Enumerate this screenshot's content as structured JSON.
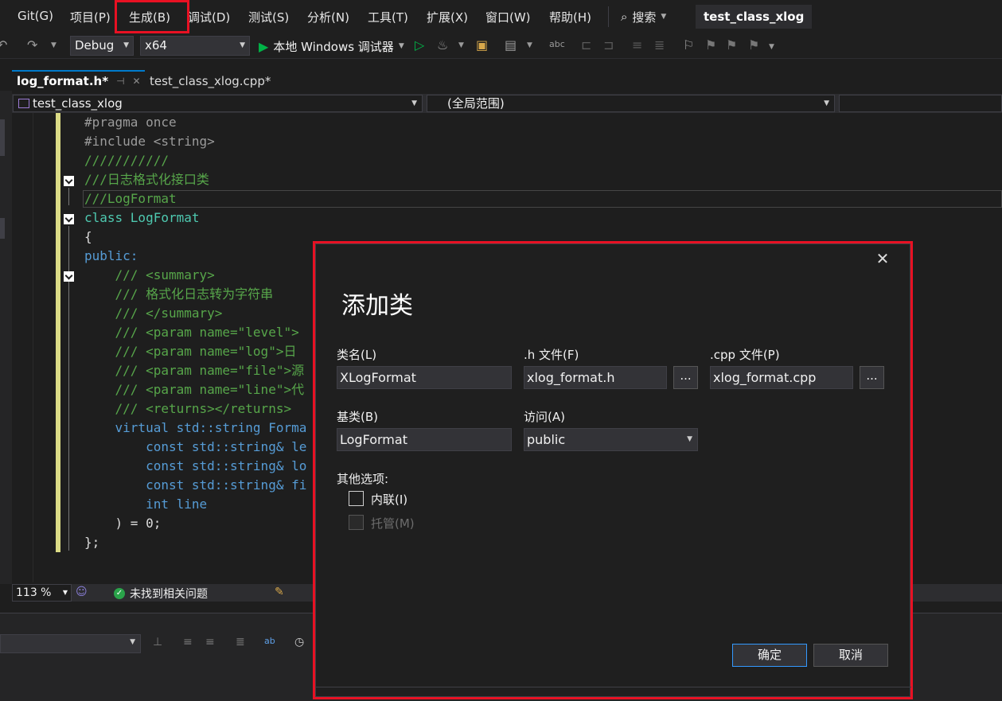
{
  "menu": {
    "items": [
      "Git(G)",
      "项目(P)",
      "生成(B)",
      "调试(D)",
      "测试(S)",
      "分析(N)",
      "工具(T)",
      "扩展(X)",
      "窗口(W)",
      "帮助(H)"
    ],
    "search_label": "搜索",
    "project_title": "test_class_xlog"
  },
  "toolbar": {
    "config": "Debug",
    "platform": "x64",
    "run_label": "本地 Windows 调试器"
  },
  "tabs": [
    {
      "label": "log_format.h*"
    },
    {
      "label": "test_class_xlog.cpp*"
    }
  ],
  "navbar": {
    "project": "test_class_xlog",
    "scope": "(全局范围)"
  },
  "code": {
    "lines": [
      "#pragma once",
      "#include <string>",
      "///////////",
      "///日志格式化接口类",
      "///LogFormat",
      "class LogFormat",
      "{",
      "public:",
      "    /// <summary>",
      "    /// 格式化日志转为字符串",
      "    /// </summary>",
      "    /// <param name=\"level\">",
      "    /// <param name=\"log\">日",
      "    /// <param name=\"file\">源",
      "    /// <param name=\"line\">代",
      "    /// <returns></returns>",
      "    virtual std::string Forma",
      "        const std::string& le",
      "        const std::string& lo",
      "        const std::string& fi",
      "        int line",
      "    ) = 0;",
      "};"
    ]
  },
  "status": {
    "zoom": "113 %",
    "issues": "未找到相关问题"
  },
  "dialog": {
    "title": "添加类",
    "class_name_label": "类名(L)",
    "class_name_value": "XLogFormat",
    "h_file_label": ".h 文件(F)",
    "h_file_value": "xlog_format.h",
    "cpp_file_label": ".cpp 文件(P)",
    "cpp_file_value": "xlog_format.cpp",
    "browse_label": "...",
    "base_label": "基类(B)",
    "base_value": "LogFormat",
    "access_label": "访问(A)",
    "access_value": "public",
    "other_options_label": "其他选项:",
    "inline_label": "内联(I)",
    "managed_label": "托管(M)",
    "ok_label": "确定",
    "cancel_label": "取消"
  },
  "colors": {
    "accent": "#007acc",
    "highlight_red": "#e81123",
    "comment_green": "#57a64a",
    "keyword_blue": "#569cd6",
    "type_teal": "#4ec9b0"
  }
}
